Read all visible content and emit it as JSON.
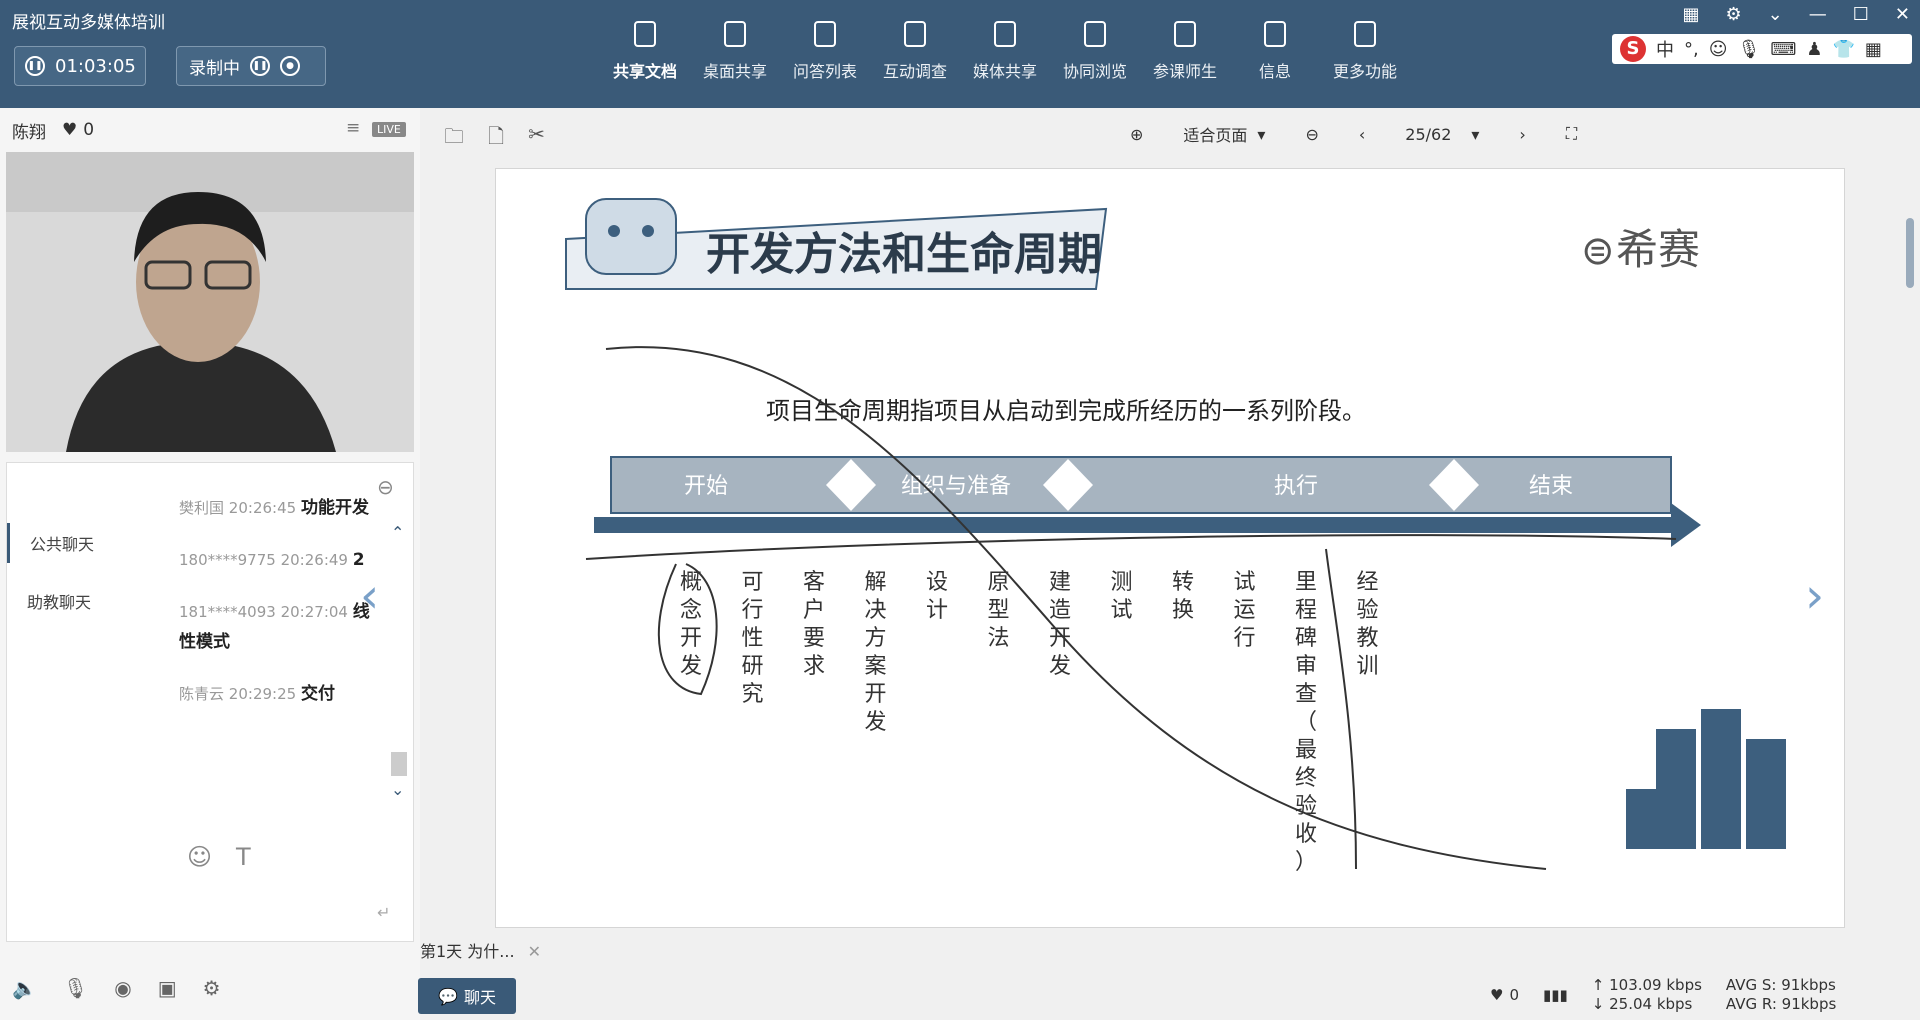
{
  "app": {
    "title": "展视互动多媒体培训"
  },
  "session": {
    "timer": "01:03:05",
    "record_label": "录制中"
  },
  "toolbar": [
    {
      "label": "共享文档",
      "icon": "document-icon"
    },
    {
      "label": "桌面共享",
      "icon": "desktop-icon"
    },
    {
      "label": "问答列表",
      "icon": "qa-icon"
    },
    {
      "label": "互动调查",
      "icon": "chart-icon"
    },
    {
      "label": "媒体共享",
      "icon": "film-icon"
    },
    {
      "label": "协同浏览",
      "icon": "compass-icon"
    },
    {
      "label": "参课师生",
      "icon": "users-icon"
    },
    {
      "label": "信息",
      "icon": "info-icon"
    },
    {
      "label": "更多功能",
      "icon": "more-icon"
    }
  ],
  "ime": {
    "lang": "中"
  },
  "presenter": {
    "name": "陈翔",
    "likes": "0",
    "live": "LIVE"
  },
  "chat": {
    "tabs": [
      "公共聊天",
      "助教聊天"
    ],
    "messages": [
      {
        "who": "樊利国",
        "time": "20:26:45",
        "text": "功能开发"
      },
      {
        "who": "180****9775",
        "time": "20:26:49",
        "text": "2"
      },
      {
        "who": "181****4093",
        "time": "20:27:04",
        "text": "线性模式"
      },
      {
        "who": "陈青云",
        "time": "20:29:25",
        "text": "交付"
      }
    ]
  },
  "doc": {
    "fit": "适合页面",
    "page": "25/62"
  },
  "slide": {
    "title": "开发方法和生命周期",
    "brand": "希赛",
    "definition": "项目生命周期指项目从启动到完成所经历的一系列阶段。",
    "phases": [
      "开始",
      "组织与准备",
      "执行",
      "结束"
    ],
    "activities": [
      "概念开发",
      "可行性研究",
      "客户要求",
      "解决方案开发",
      "设计",
      "原型法",
      "建造开发",
      "测试",
      "转换",
      "试运行",
      "里程碑审查（最终验收）",
      "经验教训"
    ]
  },
  "tab_line": {
    "label": "第1天 为什..."
  },
  "chat_button": "聊天",
  "status": {
    "likes": "0",
    "up": "103.09 kbps",
    "down": "25.04 kbps",
    "avg_s": "AVG S: 91kbps",
    "avg_r": "AVG R: 91kbps"
  },
  "colors": {
    "titlebar": "#3a5a78",
    "phase_bar": "#a7b4c0",
    "arrow": "#3d5f7e"
  }
}
